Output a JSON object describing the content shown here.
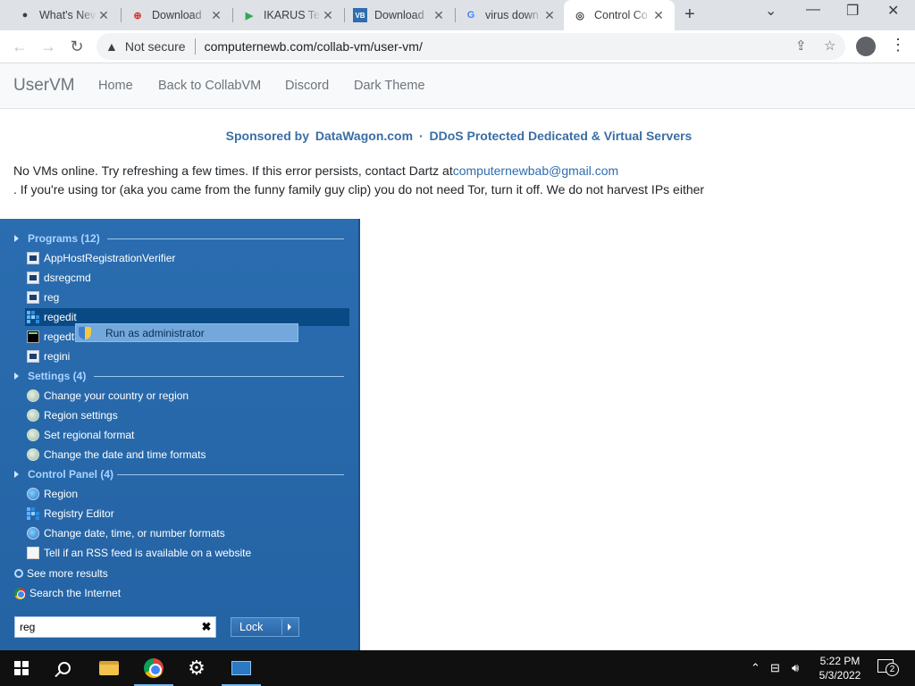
{
  "browser": {
    "tabs": [
      {
        "title": "What's New",
        "icon": "github-icon"
      },
      {
        "title": "Download",
        "icon": "antivirus-icon"
      },
      {
        "title": "IKARUS Te",
        "icon": "google-play-icon"
      },
      {
        "title": "Download",
        "icon": "vb-icon"
      },
      {
        "title": "virus down",
        "icon": "google-icon"
      },
      {
        "title": "Control Co",
        "icon": "collabvm-icon"
      }
    ],
    "security_label": "Not secure",
    "url": "computernewb.com/collab-vm/user-vm/"
  },
  "site": {
    "brand": "UserVM",
    "nav": [
      "Home",
      "Back to CollabVM",
      "Discord",
      "Dark Theme"
    ],
    "sponsor": {
      "name": "DataWagon.com",
      "prefix": "Sponsored by",
      "sep": "·",
      "suffix": "DDoS Protected Dedicated & Virtual Servers"
    },
    "message_line1": "No VMs online. Try refreshing a few times. If this error persists, contact Dartz at",
    "contact_email": "computernewbab@gmail.com",
    "message_line2": ". If you're using tor (aka you came from the funny family guy clip) you do not need Tor, turn it off. We do not harvest IPs either"
  },
  "startmenu": {
    "groups": {
      "programs": "Programs (12)",
      "settings": "Settings (4)",
      "control_panel": "Control Panel (4)"
    },
    "programs": [
      "AppHostRegistrationVerifier",
      "dsregcmd",
      "reg",
      "regedit",
      "regedt32",
      "regini"
    ],
    "settings": [
      "Change your country or region",
      "Region settings",
      "Set regional format",
      "Change the date and time formats"
    ],
    "control_panel": [
      "Region",
      "Registry Editor",
      "Change date, time, or number formats",
      "Tell if an RSS feed is available on a website"
    ],
    "see_more": "See more results",
    "search_internet": "Search the Internet",
    "search_value": "reg",
    "lock_label": "Lock",
    "context_menu": "Run as administrator"
  },
  "taskbar": {
    "time": "5:22 PM",
    "date": "5/3/2022",
    "notifications": "2"
  }
}
